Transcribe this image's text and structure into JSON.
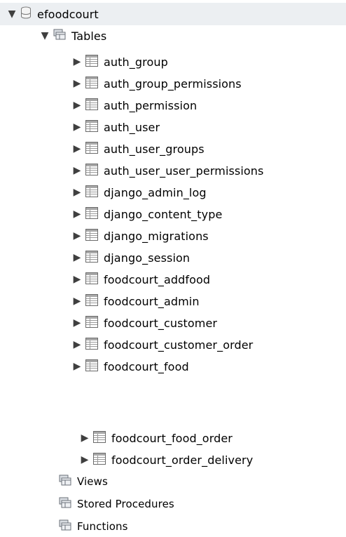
{
  "schema": {
    "name": "efoodcourt",
    "icon": "database-icon",
    "expanded": true
  },
  "tables_folder": {
    "label": "Tables",
    "icon": "folder-icon",
    "expanded": true
  },
  "tables": [
    {
      "name": "auth_group"
    },
    {
      "name": "auth_group_permissions"
    },
    {
      "name": "auth_permission"
    },
    {
      "name": "auth_user"
    },
    {
      "name": "auth_user_groups"
    },
    {
      "name": "auth_user_user_permissions"
    },
    {
      "name": "django_admin_log"
    },
    {
      "name": "django_content_type"
    },
    {
      "name": "django_migrations"
    },
    {
      "name": "django_session"
    },
    {
      "name": "foodcourt_addfood"
    },
    {
      "name": "foodcourt_admin"
    },
    {
      "name": "foodcourt_customer"
    },
    {
      "name": "foodcourt_customer_order"
    },
    {
      "name": "foodcourt_food"
    }
  ],
  "tables_continued": [
    {
      "name": "foodcourt_food_order"
    },
    {
      "name": "foodcourt_order_delivery"
    }
  ],
  "folders": [
    {
      "label": "Views",
      "icon": "folder-icon"
    },
    {
      "label": "Stored Procedures",
      "icon": "folder-icon"
    },
    {
      "label": "Functions",
      "icon": "folder-icon"
    }
  ]
}
